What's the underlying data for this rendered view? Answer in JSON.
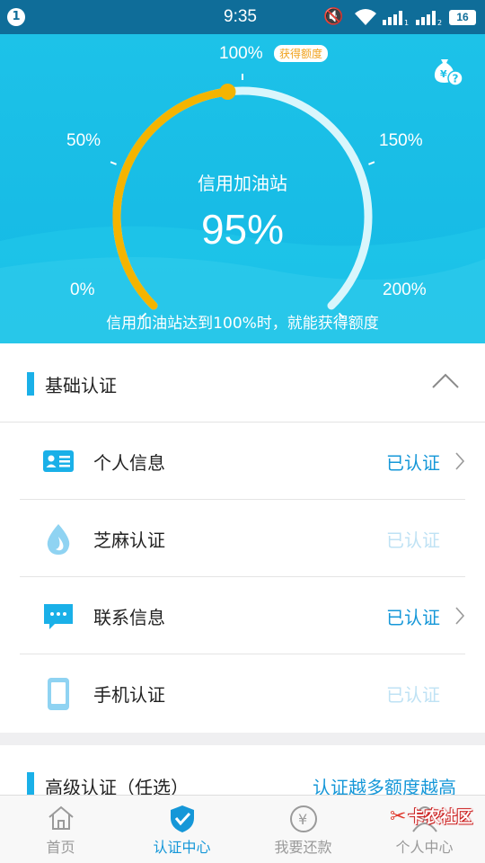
{
  "status_bar": {
    "notification_count": "1",
    "time": "9:35",
    "battery": "16"
  },
  "gauge": {
    "labels": {
      "p0": "0%",
      "p50": "50%",
      "p100": "100%",
      "p150": "150%",
      "p200": "200%"
    },
    "badge": "获得额度",
    "title": "信用加油站",
    "value": "95%",
    "progress_percent": 95,
    "max_percent": 200,
    "caption": "信用加油站达到100%时，就能获得额度",
    "colors": {
      "fill": "#f4b400",
      "track": "#d9f6fc",
      "background": "#1dc2e8"
    }
  },
  "basic": {
    "title": "基础认证",
    "items": [
      {
        "label": "个人信息",
        "status": "已认证",
        "state": "done",
        "icon": "id-card-icon",
        "arrow": true
      },
      {
        "label": "芝麻认证",
        "status": "已认证",
        "state": "pending",
        "icon": "sesame-drop-icon",
        "arrow": false
      },
      {
        "label": "联系信息",
        "status": "已认证",
        "state": "done",
        "icon": "chat-bubble-icon",
        "arrow": true
      },
      {
        "label": "手机认证",
        "status": "已认证",
        "state": "pending",
        "icon": "phone-icon",
        "arrow": false
      }
    ]
  },
  "advanced": {
    "title": "高级认证（任选）",
    "note": "认证越多额度越高"
  },
  "nav": {
    "items": [
      {
        "label": "首页",
        "icon": "home-icon",
        "active": false
      },
      {
        "label": "认证中心",
        "icon": "shield-check-icon",
        "active": true
      },
      {
        "label": "我要还款",
        "icon": "yen-coin-icon",
        "active": false
      },
      {
        "label": "个人中心",
        "icon": "person-icon",
        "active": false
      }
    ]
  },
  "watermark": "卡农社区",
  "accent_color": "#1597d8"
}
